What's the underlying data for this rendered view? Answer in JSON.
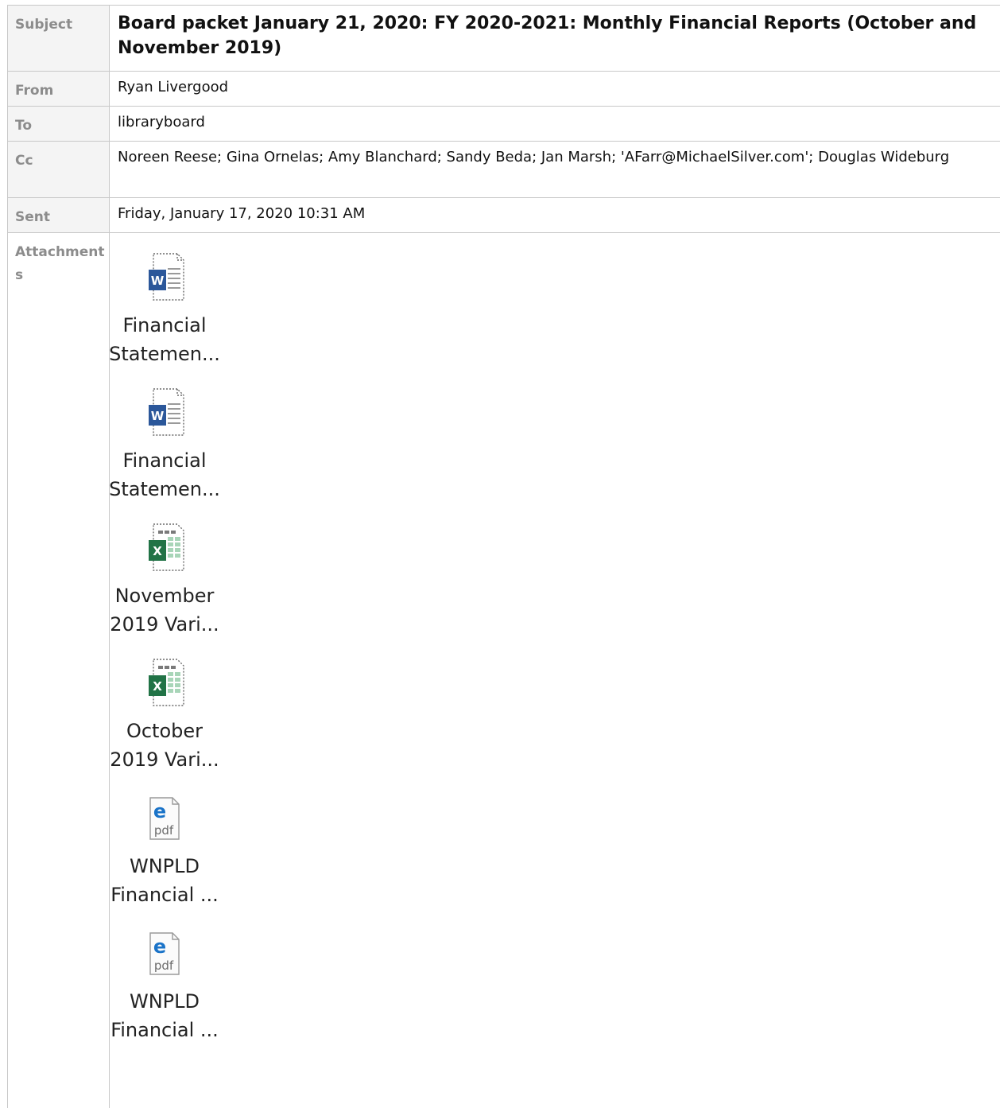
{
  "headers": {
    "subject_label": "Subject",
    "subject": "Board packet January 21, 2020: FY 2020-2021: Monthly Financial Reports (October and November 2019)",
    "from_label": "From",
    "from": "Ryan Livergood",
    "to_label": "To",
    "to": "libraryboard",
    "cc_label": "Cc",
    "cc": "Noreen Reese; Gina Ornelas; Amy Blanchard; Sandy Beda; Jan Marsh; 'AFarr@MichaelSilver.com'; Douglas Wideburg",
    "sent_label": "Sent",
    "sent": "Friday, January 17, 2020 10:31 AM",
    "attachments_label": "Attachments"
  },
  "attachments": [
    {
      "line1": "Financial",
      "line2": "Statemen...",
      "icon": "word-document-icon"
    },
    {
      "line1": "Financial",
      "line2": "Statemen...",
      "icon": "word-document-icon"
    },
    {
      "line1": "November",
      "line2": "2019 Vari...",
      "icon": "excel-spreadsheet-icon"
    },
    {
      "line1": "October",
      "line2": "2019 Vari...",
      "icon": "excel-spreadsheet-icon"
    },
    {
      "line1": "WNPLD",
      "line2": "Financial ...",
      "icon": "pdf-file-icon"
    },
    {
      "line1": "WNPLD",
      "line2": "Financial ...",
      "icon": "pdf-file-icon"
    }
  ],
  "colors": {
    "word": "#2b579a",
    "excel": "#217346",
    "edge_pdf": "#1a73c8",
    "border": "#c8c8c8",
    "label_text": "#8c8c8c"
  }
}
